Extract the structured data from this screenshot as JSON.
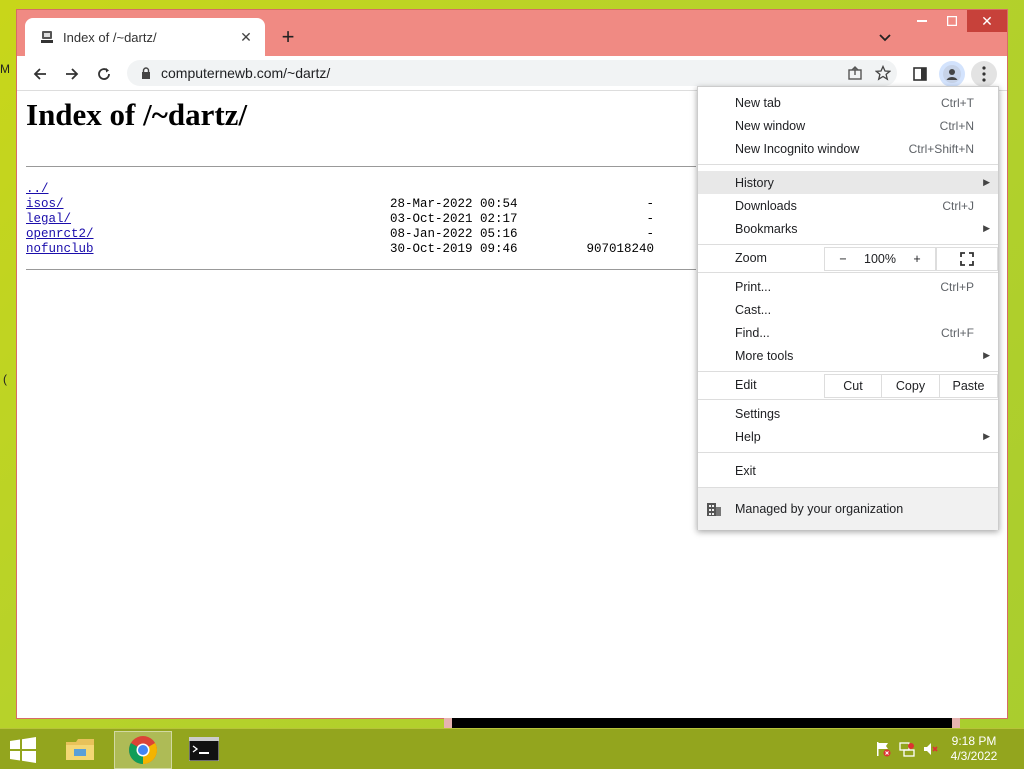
{
  "browser": {
    "tab_title": "Index of /~dartz/",
    "url": "computernewb.com/~dartz/"
  },
  "page": {
    "heading": "Index of /~dartz/",
    "entries": [
      {
        "name": "../",
        "date": "",
        "size": ""
      },
      {
        "name": "isos/",
        "date": "28-Mar-2022 00:54",
        "size": "-"
      },
      {
        "name": "legal/",
        "date": "03-Oct-2021 02:17",
        "size": "-"
      },
      {
        "name": "openrct2/",
        "date": "08-Jan-2022 05:16",
        "size": "-"
      },
      {
        "name": "nofunclub",
        "date": "30-Oct-2019 09:46",
        "size": "907018240"
      }
    ]
  },
  "menu": {
    "new_tab": {
      "label": "New tab",
      "shortcut": "Ctrl+T"
    },
    "new_window": {
      "label": "New window",
      "shortcut": "Ctrl+N"
    },
    "incognito": {
      "label": "New Incognito window",
      "shortcut": "Ctrl+Shift+N"
    },
    "history": {
      "label": "History"
    },
    "downloads": {
      "label": "Downloads",
      "shortcut": "Ctrl+J"
    },
    "bookmarks": {
      "label": "Bookmarks"
    },
    "zoom": {
      "label": "Zoom",
      "minus": "−",
      "value": "100%",
      "plus": "+"
    },
    "print": {
      "label": "Print...",
      "shortcut": "Ctrl+P"
    },
    "cast": {
      "label": "Cast..."
    },
    "find": {
      "label": "Find...",
      "shortcut": "Ctrl+F"
    },
    "more_tools": {
      "label": "More tools"
    },
    "edit": {
      "label": "Edit",
      "cut": "Cut",
      "copy": "Copy",
      "paste": "Paste"
    },
    "settings": {
      "label": "Settings"
    },
    "help": {
      "label": "Help"
    },
    "exit": {
      "label": "Exit"
    },
    "managed": {
      "label": "Managed by your organization"
    }
  },
  "taskbar": {
    "time": "9:18 PM",
    "date": "4/3/2022",
    "apps": [
      "file-explorer-icon",
      "chrome-icon",
      "command-prompt-icon"
    ]
  },
  "colors": {
    "window_frame": "#f08a83",
    "desktop": "#b7d22a",
    "taskbar": "#93a51e",
    "link": "#1a0dab"
  }
}
